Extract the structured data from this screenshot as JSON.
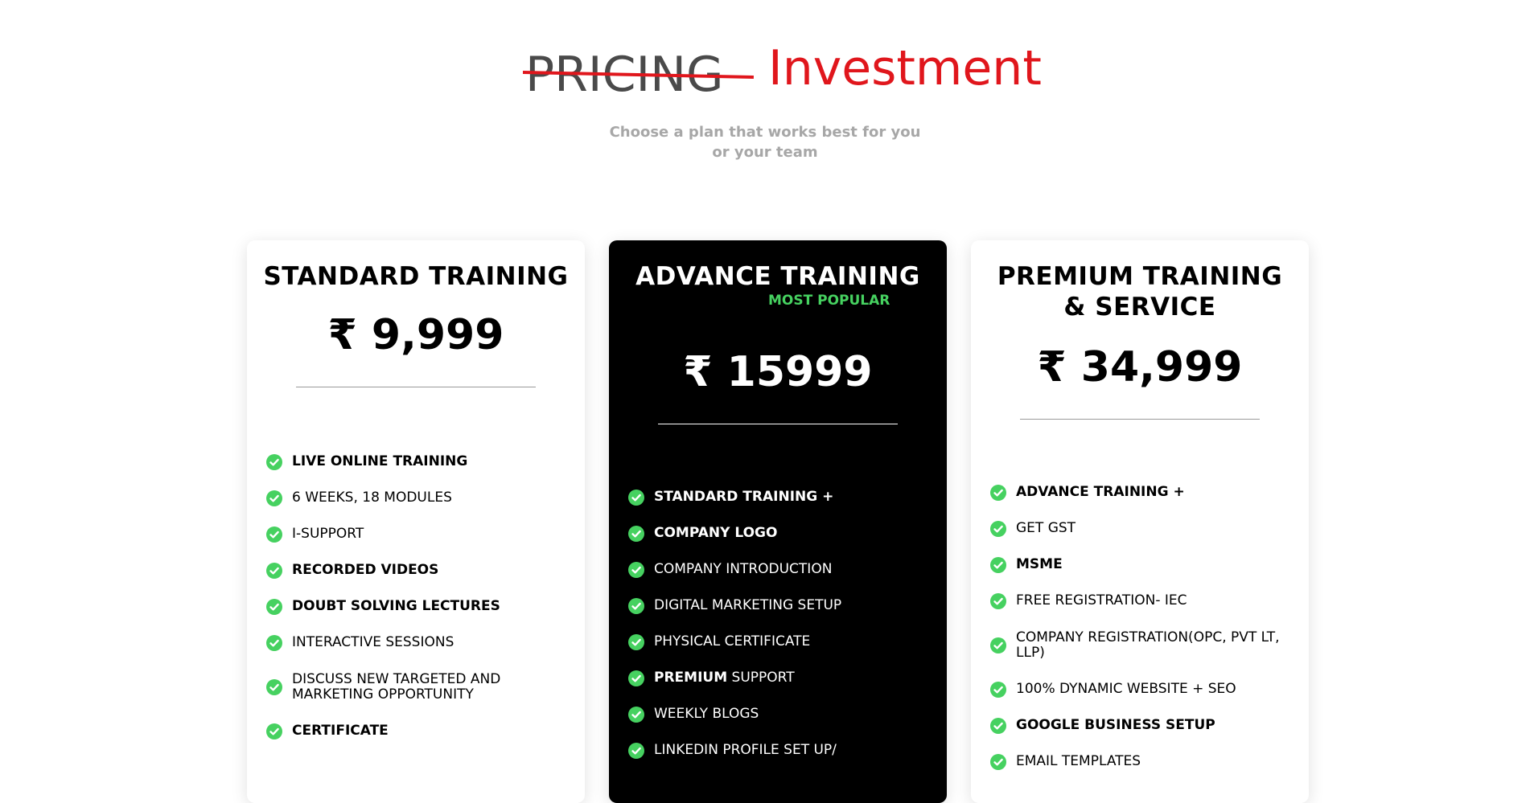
{
  "header": {
    "old_title": "PRICING",
    "new_title": "Investment",
    "subtitle_line1": "Choose a plan that works best for you",
    "subtitle_line2": "or your team"
  },
  "colors": {
    "accent_red": "#e0161c",
    "check_green": "#46d160",
    "subtitle_gray": "#a7a7a7"
  },
  "plans": [
    {
      "name": "STANDARD TRAINING",
      "price": "₹ 9,999",
      "features": [
        {
          "text": "LIVE ONLINE TRAINING",
          "bold": true
        },
        {
          "text": "6 WEEKS, 18 MODULES",
          "bold": false
        },
        {
          "text": "I-SUPPORT",
          "bold": false
        },
        {
          "text": "RECORDED VIDEOS",
          "bold": true
        },
        {
          "text": "DOUBT SOLVING LECTURES",
          "bold": true
        },
        {
          "text": "INTERACTIVE SESSIONS",
          "bold": false
        },
        {
          "text": "DISCUSS NEW TARGETED AND MARKETING OPPORTUNITY",
          "bold": false
        },
        {
          "text": "CERTIFICATE",
          "bold": true
        }
      ]
    },
    {
      "name": "ADVANCE TRAINING",
      "badge": "MOST POPULAR",
      "price": "₹ 15999",
      "features": [
        {
          "text": "STANDARD TRAINING +",
          "bold": true
        },
        {
          "text": "COMPANY LOGO",
          "bold": true
        },
        {
          "text": "COMPANY INTRODUCTION",
          "bold": false
        },
        {
          "text": "DIGITAL MARKETING SETUP",
          "bold": false
        },
        {
          "text": "PHYSICAL CERTIFICATE",
          "bold": false
        },
        {
          "prefix": "PREMIUM",
          "text": " SUPPORT",
          "bold": false
        },
        {
          "text": "WEEKLY BLOGS",
          "bold": false
        },
        {
          "text": "LINKEDIN PROFILE SET UP/",
          "bold": false
        }
      ]
    },
    {
      "name_line1": "PREMIUM TRAINING",
      "name_line2": "& SERVICE",
      "price": "₹ 34,999",
      "features": [
        {
          "text": "ADVANCE TRAINING +",
          "bold": true
        },
        {
          "text": "GET GST",
          "bold": false
        },
        {
          "text": "MSME",
          "bold": true
        },
        {
          "text": "FREE REGISTRATION- IEC",
          "bold": false
        },
        {
          "text": "COMPANY REGISTRATION(OPC, PVT LT, LLP)",
          "bold": false
        },
        {
          "text": "100% DYNAMIC WEBSITE + SEO",
          "bold": false
        },
        {
          "text": "GOOGLE BUSINESS SETUP",
          "bold": true
        },
        {
          "text": "EMAIL TEMPLATES",
          "bold": false
        }
      ]
    }
  ]
}
